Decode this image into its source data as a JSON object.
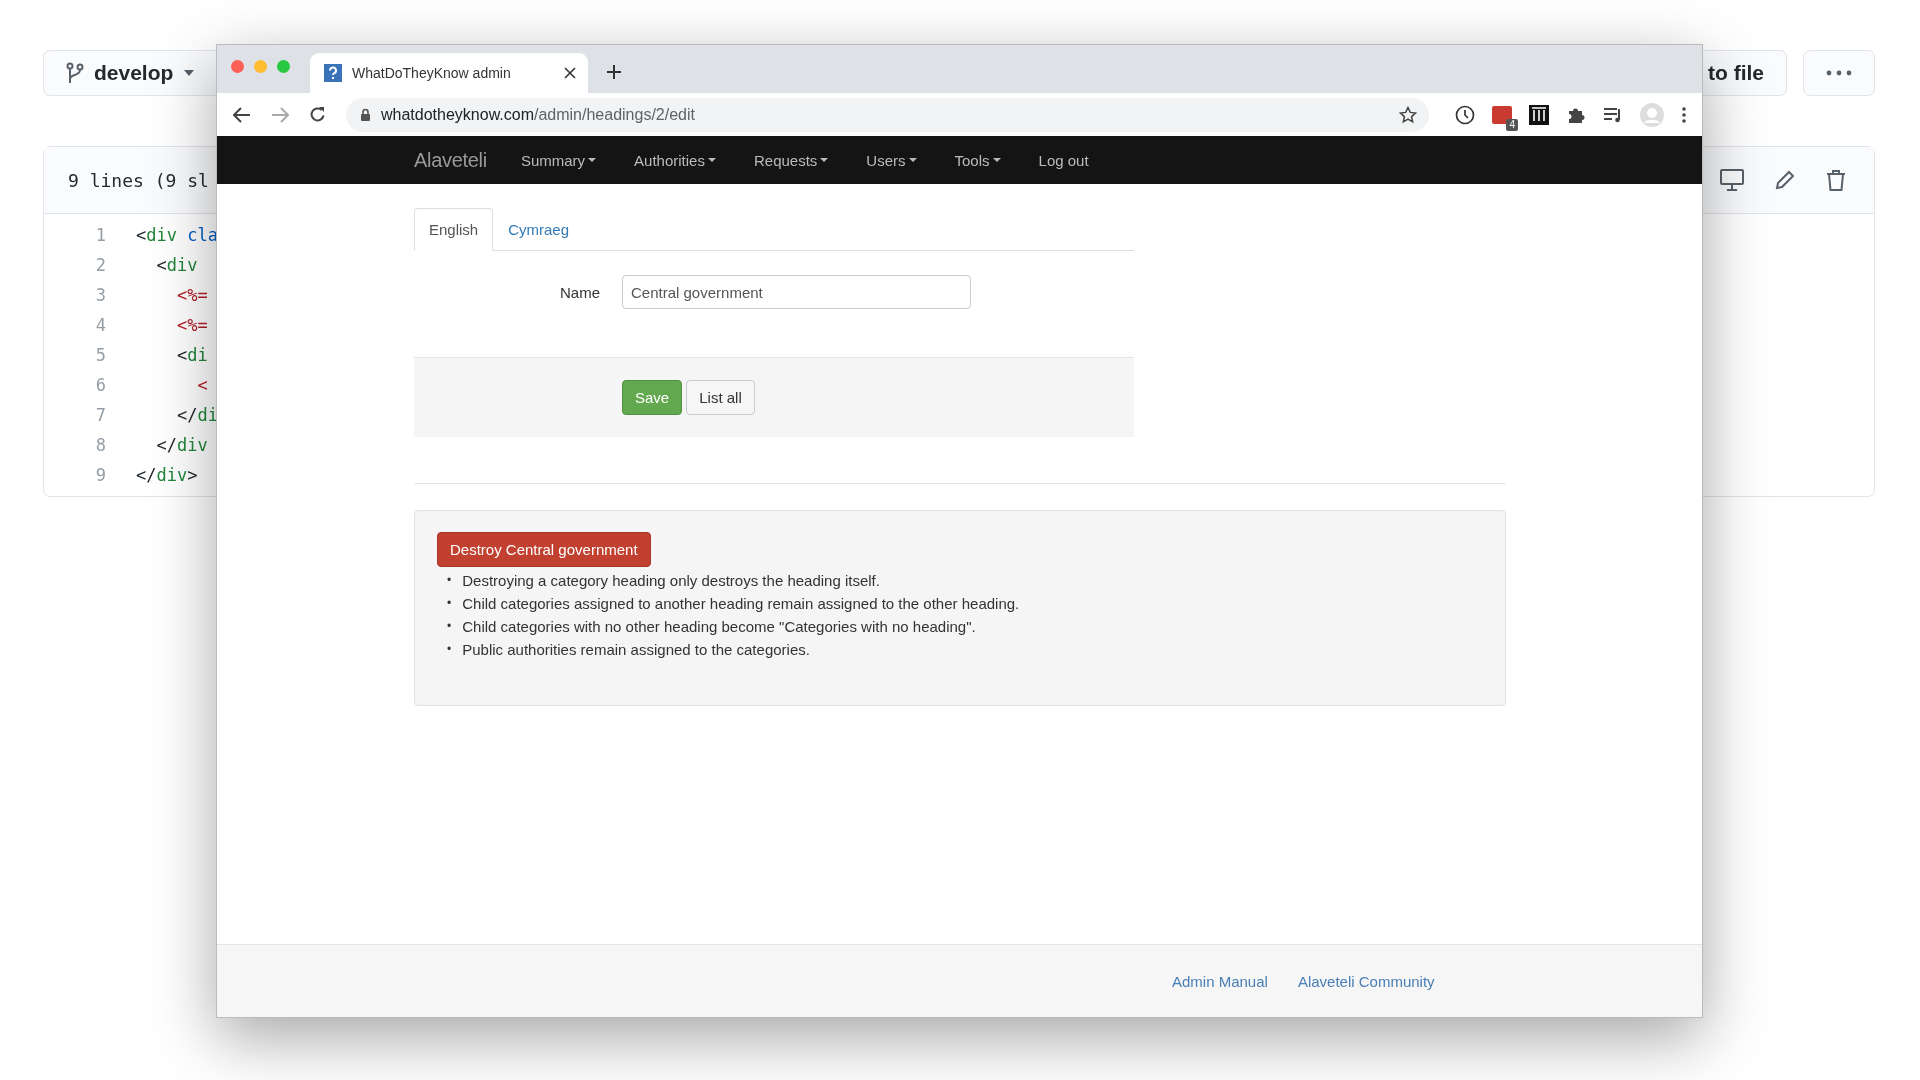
{
  "background_page": {
    "branch_button": {
      "label": "develop"
    },
    "goto_button": {
      "label": "to file"
    },
    "file_header": {
      "summary": "9 lines (9 sl"
    },
    "code_lines": [
      {
        "number": "1",
        "tokens": [
          {
            "text": "<",
            "kind": "punct"
          },
          {
            "text": "div",
            "kind": "tag"
          },
          {
            "text": " cla",
            "kind": "attr"
          }
        ]
      },
      {
        "number": "2",
        "tokens": [
          {
            "text": "  <",
            "kind": "punct"
          },
          {
            "text": "div",
            "kind": "tag"
          }
        ]
      },
      {
        "number": "3",
        "tokens": [
          {
            "text": "    <%=",
            "kind": "erb"
          }
        ]
      },
      {
        "number": "4",
        "tokens": [
          {
            "text": "    <%=",
            "kind": "erb"
          }
        ]
      },
      {
        "number": "5",
        "tokens": [
          {
            "text": "    <",
            "kind": "punct"
          },
          {
            "text": "di",
            "kind": "tag"
          }
        ]
      },
      {
        "number": "6",
        "tokens": [
          {
            "text": "      <",
            "kind": "erb"
          }
        ]
      },
      {
        "number": "7",
        "tokens": [
          {
            "text": "    </",
            "kind": "punct"
          },
          {
            "text": "di",
            "kind": "tag"
          }
        ]
      },
      {
        "number": "8",
        "tokens": [
          {
            "text": "  </",
            "kind": "punct"
          },
          {
            "text": "div",
            "kind": "tag"
          }
        ]
      },
      {
        "number": "9",
        "tokens": [
          {
            "text": "</",
            "kind": "punct"
          },
          {
            "text": "div",
            "kind": "tag"
          },
          {
            "text": ">",
            "kind": "punct"
          }
        ]
      }
    ]
  },
  "browser": {
    "tabs": [
      {
        "title": "WhatDoTheyKnow admin",
        "selected": true
      }
    ],
    "url": {
      "domain": "whatdotheyknow.com",
      "path": "/admin/headings/2/edit"
    },
    "extension_badge": "4"
  },
  "navbar": {
    "brand": "Alaveteli",
    "items": [
      {
        "label": "Summary",
        "dropdown": true
      },
      {
        "label": "Authorities",
        "dropdown": true
      },
      {
        "label": "Requests",
        "dropdown": true
      },
      {
        "label": "Users",
        "dropdown": true
      },
      {
        "label": "Tools",
        "dropdown": true
      },
      {
        "label": "Log out",
        "dropdown": false
      }
    ]
  },
  "language_tabs": [
    {
      "label": "English",
      "selected": true
    },
    {
      "label": "Cymraeg",
      "selected": false
    }
  ],
  "form": {
    "name_label": "Name",
    "name_value": "Central government",
    "save_button": "Save",
    "list_all_button": "List all"
  },
  "destroy": {
    "button": "Destroy Central government",
    "bullet": "•",
    "notes": [
      "Destroying a category heading only destroys the heading itself.",
      "Child categories assigned to another heading remain assigned to the other heading.",
      "Child categories with no other heading become \"Categories with no heading\".",
      "Public authorities remain assigned to the categories."
    ]
  },
  "footer": {
    "links": [
      "Admin Manual",
      "Alaveteli Community"
    ]
  }
}
